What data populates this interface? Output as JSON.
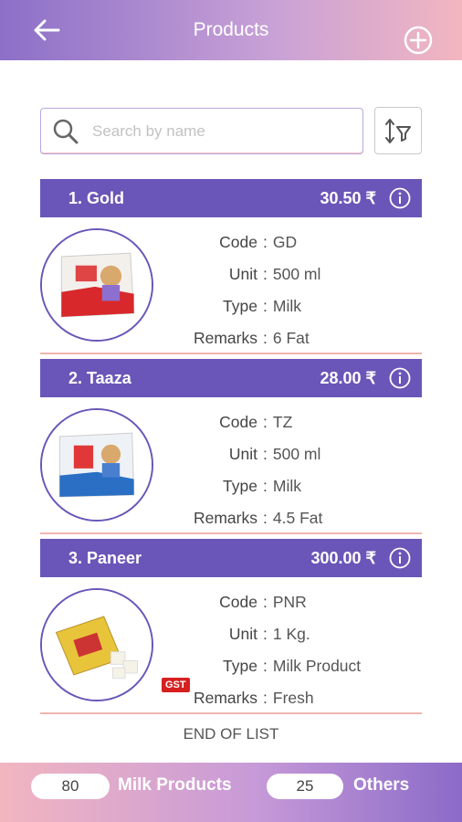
{
  "header": {
    "title": "Products"
  },
  "search": {
    "placeholder": "Search by name"
  },
  "products": [
    {
      "name": "1. Gold",
      "price": "30.50 ₹",
      "code": "GD",
      "unit": "500 ml",
      "type": "Milk",
      "remarks": "6 Fat",
      "badge": ""
    },
    {
      "name": "2. Taaza",
      "price": "28.00 ₹",
      "code": "TZ",
      "unit": "500 ml",
      "type": "Milk",
      "remarks": "4.5 Fat",
      "badge": ""
    },
    {
      "name": "3. Paneer",
      "price": "300.00 ₹",
      "code": "PNR",
      "unit": "1 Kg.",
      "type": "Milk Product",
      "remarks": "Fresh",
      "badge": "GST"
    }
  ],
  "labels": {
    "code": "Code",
    "unit": "Unit",
    "type": "Type",
    "remarks": "Remarks",
    "colon": ":"
  },
  "end_of_list": "END OF LIST",
  "footer": {
    "milk_count": "80",
    "milk_label": "Milk Products",
    "others_count": "25",
    "others_label": "Others"
  },
  "colors": {
    "accent": "#6a56b8",
    "badge": "#d62020",
    "divider": "#f0b6b0"
  },
  "icons": {
    "back": "arrow-left-icon",
    "add": "plus-circle-icon",
    "search": "search-icon",
    "sort": "sort-filter-icon",
    "info": "info-icon"
  }
}
